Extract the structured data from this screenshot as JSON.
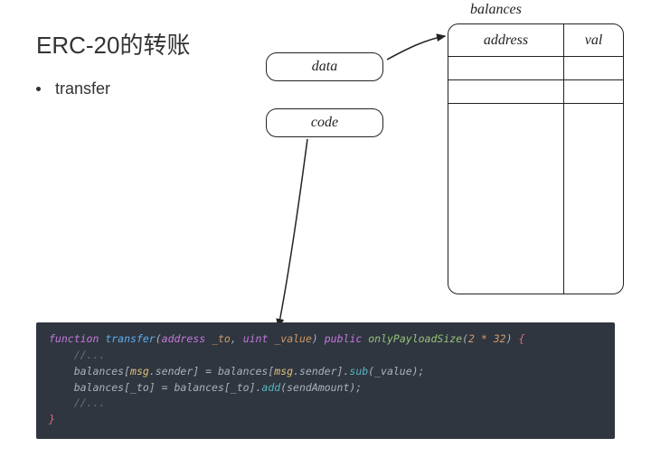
{
  "title": "ERC-20的转账",
  "bullets": [
    "transfer"
  ],
  "boxes": {
    "data": "data",
    "code": "code"
  },
  "table": {
    "label": "balances",
    "headers": {
      "address": "address",
      "val": "val"
    }
  },
  "code": {
    "kw_function": "function",
    "fn_name": "transfer",
    "type_address": "address",
    "param_to": "_to",
    "type_uint": "uint",
    "param_value": "_value",
    "kw_public": "public",
    "modifier": "onlyPayloadSize",
    "modifier_arg": "2 * 32",
    "comment": "//...",
    "line2_a": "balances[",
    "msg": "msg",
    "sender": ".sender",
    "line2_b": "] = balances[",
    "line2_c": "].",
    "sub": "sub",
    "line2_d": "(_value);",
    "line3_a": "balances[_to] = balances[_to].",
    "add": "add",
    "line3_b": "(sendAmount);"
  }
}
